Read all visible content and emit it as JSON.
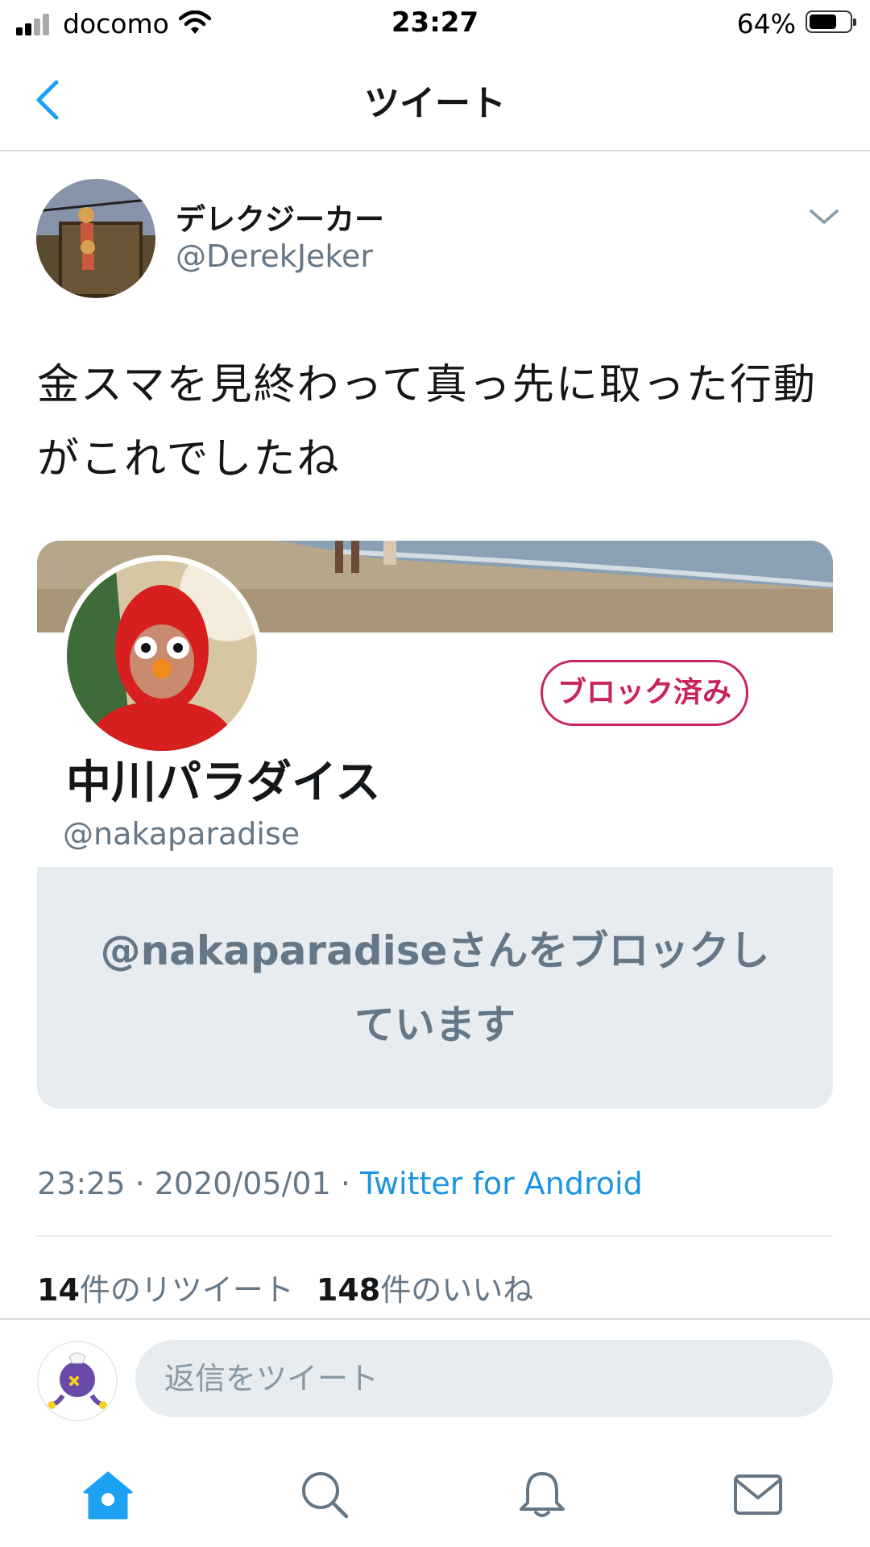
{
  "status_bar": {
    "carrier": "docomo",
    "time": "23:27",
    "battery_percent": "64%",
    "battery_level": 0.64,
    "icons": [
      "signal-icon",
      "wifi-icon",
      "battery-icon"
    ]
  },
  "nav": {
    "title": "ツイート",
    "back_icon": "chevron-left-icon"
  },
  "tweet": {
    "author_name": "デレクジーカー",
    "author_handle": "@DerekJeker",
    "text": "金スマを見終わって真っ先に取った行動がこれでしたね",
    "menu_icon": "chevron-down-icon",
    "timestamp": "23:25 · 2020/05/01 · ",
    "source": "Twitter for Android",
    "retweet_count": "14",
    "retweet_label": "件のリツイート",
    "like_count": "148",
    "like_label": "件のいいね"
  },
  "card": {
    "name": "中川パラダイス",
    "handle": "@nakaparadise",
    "blocked_button": "ブロック済み",
    "blocked_message": "@nakaparadiseさんをブロックしています"
  },
  "reply": {
    "placeholder": "返信をツイート"
  },
  "tab_bar": {
    "tabs": [
      "home-icon",
      "search-icon",
      "notifications-icon",
      "messages-icon"
    ],
    "active": "home-icon",
    "active_color": "#1da1f2"
  },
  "colors": {
    "accent": "#1da1f2",
    "blocked": "#c9245a",
    "secondary_text": "#657786"
  }
}
